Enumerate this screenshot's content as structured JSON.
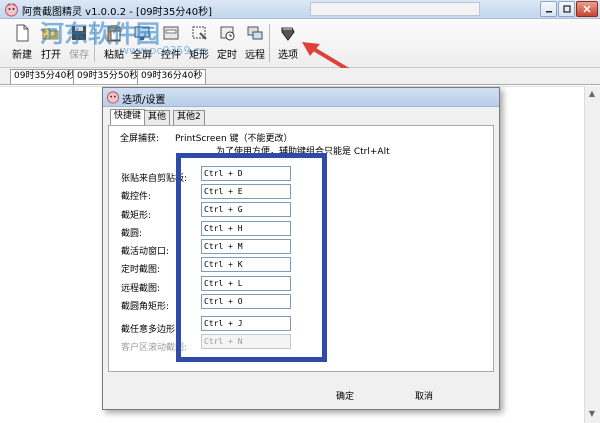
{
  "window": {
    "title": "阿贵截图精灵 v1.0.0.2 - [09时35分40秒]",
    "buttons": [
      "0",
      "1",
      "r"
    ]
  },
  "toolbar": {
    "items": [
      {
        "label": "新建",
        "icon": "new-icon"
      },
      {
        "label": "打开",
        "icon": "open-icon"
      },
      {
        "label": "保存",
        "icon": "save-icon"
      },
      {
        "label": "粘贴",
        "icon": "paste-icon"
      },
      {
        "label": "全屏",
        "icon": "fullscreen-icon"
      },
      {
        "label": "控件",
        "icon": "control-icon"
      },
      {
        "label": "矩形",
        "icon": "rectangle-icon"
      },
      {
        "label": "定时",
        "icon": "timer-icon"
      },
      {
        "label": "远程",
        "icon": "remote-icon"
      },
      {
        "label": "选项",
        "icon": "options-icon"
      }
    ]
  },
  "tabs": [
    "09时35分40秒",
    "09时35分50秒",
    "09时36分40秒"
  ],
  "watermark": {
    "text": "河东软件园",
    "url": "www.pc0359.cn"
  },
  "dialog": {
    "title": "选项/设置",
    "tabs": [
      "快捷键",
      "其他",
      "其他2"
    ],
    "fullscreen_label": "全屏捕获:",
    "fullscreen_key": "PrintScreen 键（不能更改）",
    "note": "为了使用方便，辅助键组合只能是 Ctrl+Alt",
    "hotkeys": [
      {
        "label": "张贴来自剪贴板:",
        "value": "Ctrl + D",
        "disabled": false
      },
      {
        "label": "截控件:",
        "value": "Ctrl + E",
        "disabled": false
      },
      {
        "label": "截矩形:",
        "value": "Ctrl + G",
        "disabled": false
      },
      {
        "label": "截圆:",
        "value": "Ctrl + H",
        "disabled": false
      },
      {
        "label": "截活动窗口:",
        "value": "Ctrl + M",
        "disabled": false
      },
      {
        "label": "定时截图:",
        "value": "Ctrl + K",
        "disabled": false
      },
      {
        "label": "远程截图:",
        "value": "Ctrl + L",
        "disabled": false
      },
      {
        "label": "截圆角矩形:",
        "value": "Ctrl + O",
        "disabled": false
      },
      {
        "label": "截任意多边形:",
        "value": "Ctrl + J",
        "disabled": false
      },
      {
        "label": "客户区滚动截图:",
        "value": "Ctrl + N",
        "disabled": true
      }
    ],
    "ok_label": "确定",
    "cancel_label": "取消"
  },
  "colors": {
    "highlight": "#2f4aa8",
    "arrow": "#e0403a"
  }
}
